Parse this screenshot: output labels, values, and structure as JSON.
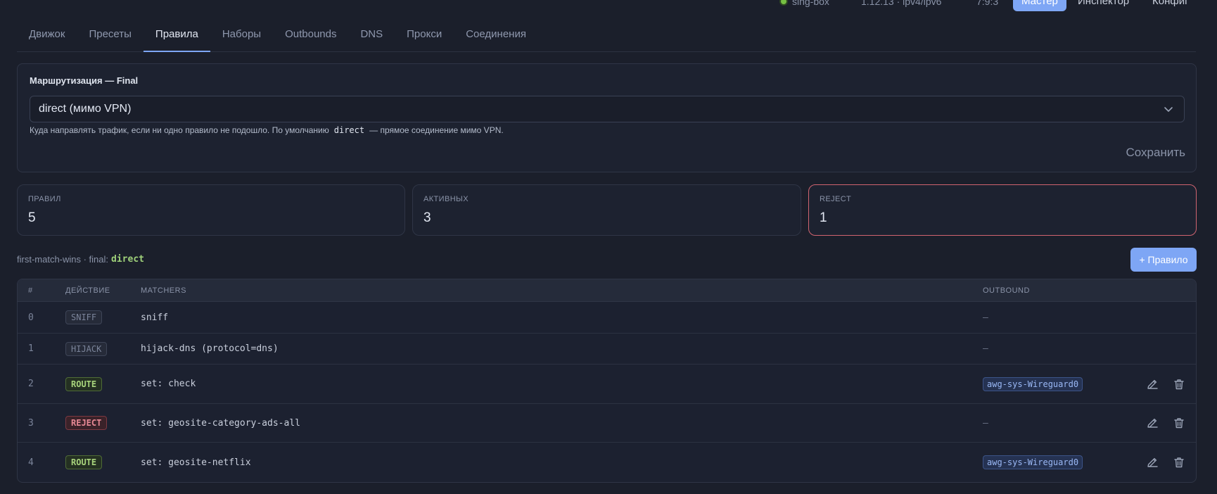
{
  "header": {
    "status_label": "sing-box",
    "version": "1.12.13 · ipv4/ipv6",
    "port": "7:9:3",
    "modes": [
      {
        "label": "Мастер",
        "active": true
      },
      {
        "label": "Инспектор",
        "active": false
      },
      {
        "label": "Конфиг",
        "active": false
      }
    ]
  },
  "tabs": [
    {
      "label": "Движок",
      "active": false
    },
    {
      "label": "Пресеты",
      "active": false
    },
    {
      "label": "Правила",
      "active": true
    },
    {
      "label": "Наборы",
      "active": false
    },
    {
      "label": "Outbounds",
      "active": false
    },
    {
      "label": "DNS",
      "active": false
    },
    {
      "label": "Прокси",
      "active": false
    },
    {
      "label": "Соединения",
      "active": false
    }
  ],
  "final_routing": {
    "title": "Маршрутизация — Final",
    "selected": "direct (мимо VPN)",
    "hint_prefix": "Куда направлять трафик, если ни одно правило не подошло. По умолчанию",
    "hint_code": "direct",
    "hint_suffix": "— прямое соединение мимо VPN.",
    "save_label": "Сохранить"
  },
  "stats": [
    {
      "key": "ПРАВИЛ",
      "value": "5",
      "variant": "normal"
    },
    {
      "key": "АКТИВНЫХ",
      "value": "3",
      "variant": "normal"
    },
    {
      "key": "REJECT",
      "value": "1",
      "variant": "reject"
    }
  ],
  "summary": {
    "prefix": "first-match-wins · final:",
    "final_value": "direct"
  },
  "add_rule_label": "+ Правило",
  "table": {
    "headers": {
      "index": "#",
      "action": "ДЕЙСТВИЕ",
      "matchers": "MATCHERS",
      "outbound": "OUTBOUND"
    },
    "rows": [
      {
        "index": "0",
        "action": "SNIFF",
        "action_kind": "sniff",
        "matchers": "sniff",
        "outbound": "—",
        "editable": false
      },
      {
        "index": "1",
        "action": "HIJACK",
        "action_kind": "hijack",
        "matchers": "hijack-dns (protocol=dns)",
        "outbound": "—",
        "editable": false
      },
      {
        "index": "2",
        "action": "ROUTE",
        "action_kind": "route",
        "matchers": "set: check",
        "outbound": "awg-sys-Wireguard0",
        "editable": true
      },
      {
        "index": "3",
        "action": "REJECT",
        "action_kind": "reject",
        "matchers": "set: geosite-category-ads-all",
        "outbound": "—",
        "editable": true
      },
      {
        "index": "4",
        "action": "ROUTE",
        "action_kind": "route",
        "matchers": "set: geosite-netflix",
        "outbound": "awg-sys-Wireguard0",
        "editable": true
      }
    ]
  },
  "colors": {
    "accent": "#7ea6f5",
    "route": "#a8d47c",
    "reject": "#ea8a96",
    "background": "#1b1f2b"
  },
  "icons": [
    "chevron-down-icon",
    "edit-icon",
    "trash-icon",
    "status-dot-icon"
  ]
}
